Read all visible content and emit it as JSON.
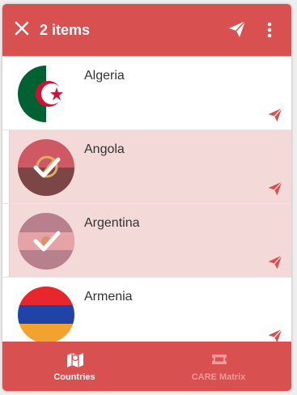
{
  "appbar": {
    "title": "2 items"
  },
  "countries": [
    {
      "name": "Algeria",
      "selected": false,
      "flag": "algeria-flag"
    },
    {
      "name": "Angola",
      "selected": true,
      "flag": "angola-flag"
    },
    {
      "name": "Argentina",
      "selected": true,
      "flag": "argentina-flag"
    },
    {
      "name": "Armenia",
      "selected": false,
      "flag": "armenia-flag"
    }
  ],
  "nav": [
    {
      "label": "Countries",
      "icon": "map-icon",
      "active": true
    },
    {
      "label": "CARE Matrix",
      "icon": "ticket-icon",
      "active": false
    }
  ],
  "colors": {
    "primary": "#d95050",
    "selected_row": "#f4d9d9"
  }
}
